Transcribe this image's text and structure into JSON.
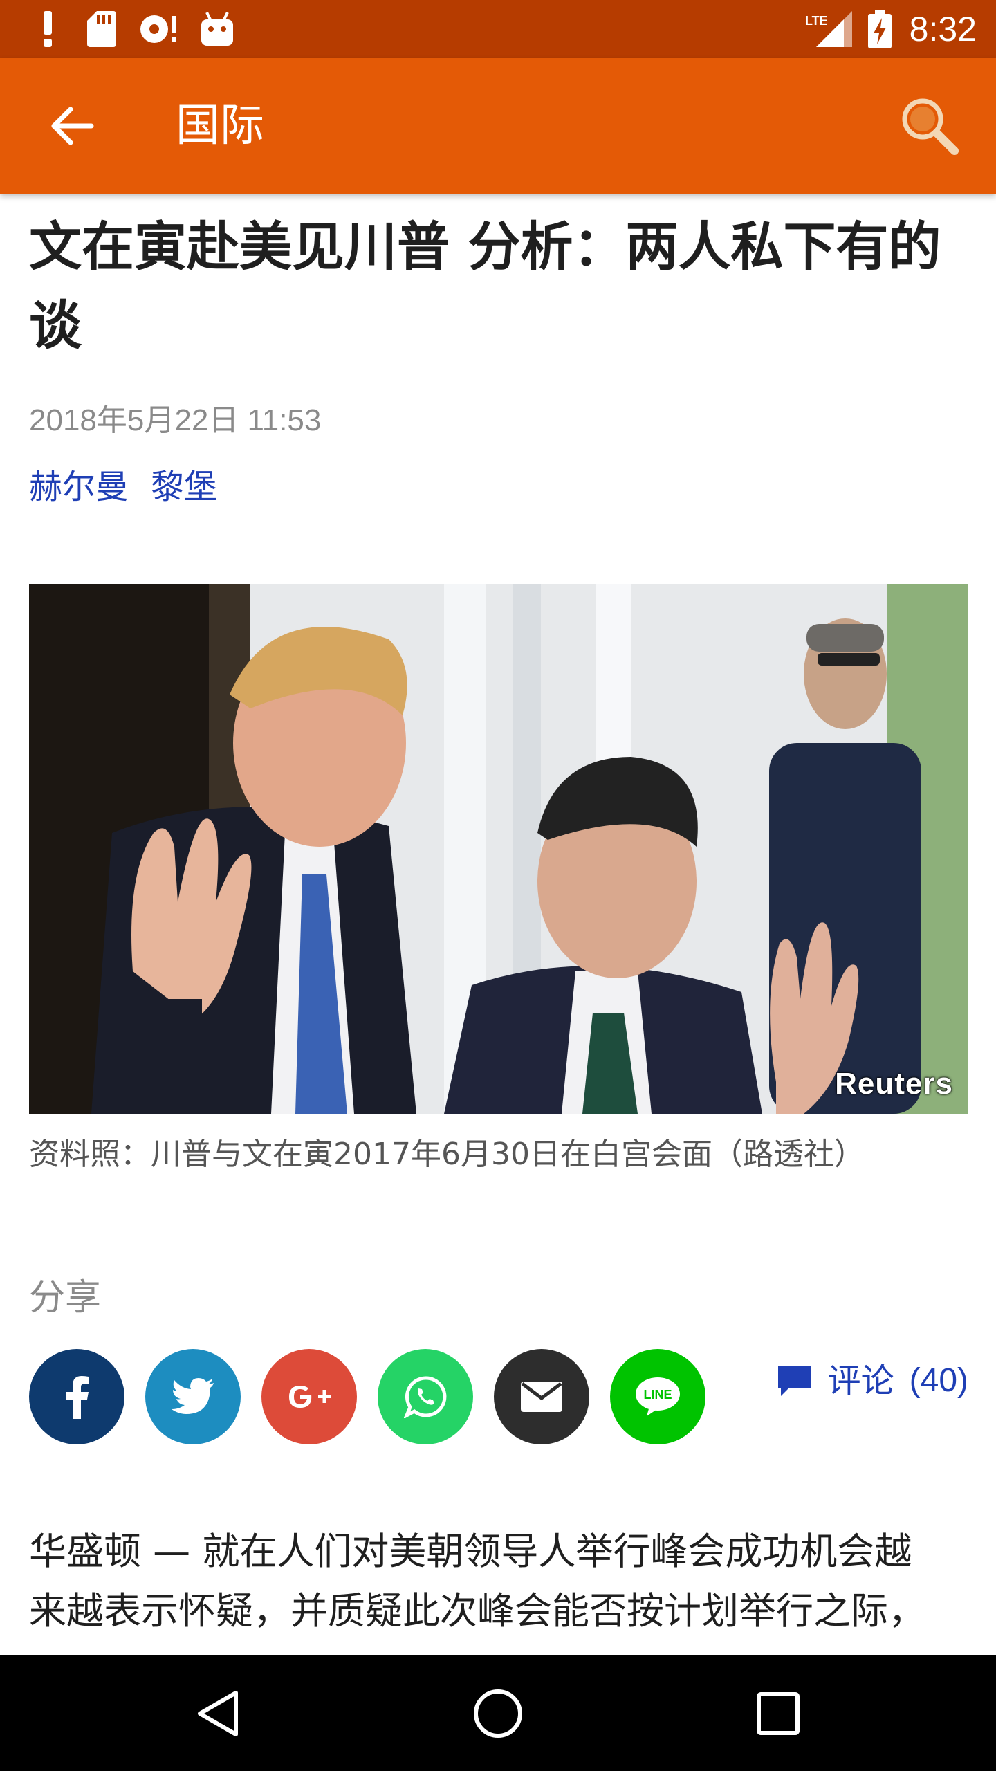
{
  "status_bar": {
    "time": "8:32",
    "network": "LTE",
    "icons": [
      "alert-icon",
      "sd-card-icon",
      "sync-icon",
      "android-icon",
      "signal-icon",
      "battery-charging-icon"
    ]
  },
  "app_bar": {
    "title": "国际",
    "back_icon": "arrow-left-icon",
    "search_icon": "search-icon"
  },
  "article": {
    "headline": "文在寅赴美见川普 分析：两人私下有的谈",
    "date": "2018年5月22日 11:53",
    "authors": [
      "赫尔曼",
      "黎堡"
    ],
    "photo_watermark": "Reuters",
    "caption": "资料照：川普与文在寅2017年6月30日在白宫会面（路透社）",
    "body_lines": [
      "华盛顿 — 就在人们对美朝领导人举行峰会成功机会越",
      "来越表示怀疑，并质疑此次峰会能否按计划举行之际，"
    ]
  },
  "share": {
    "label": "分享",
    "buttons": [
      {
        "name": "facebook",
        "icon": "facebook-icon",
        "color": "#0e3a6e"
      },
      {
        "name": "twitter",
        "icon": "twitter-icon",
        "color": "#1d8dc0"
      },
      {
        "name": "google-plus",
        "icon": "google-plus-icon",
        "color": "#dd4b39"
      },
      {
        "name": "whatsapp",
        "icon": "whatsapp-icon",
        "color": "#25d366"
      },
      {
        "name": "email",
        "icon": "email-icon",
        "color": "#2d2d2d"
      },
      {
        "name": "line",
        "icon": "line-icon",
        "color": "#00c300"
      }
    ]
  },
  "comments": {
    "label": "评论",
    "count": "(40)",
    "icon": "comment-icon",
    "color": "#1f3fb5"
  },
  "colors": {
    "status_bar": "#b63c00",
    "app_bar": "#e45a06",
    "link": "#1f3fb5"
  },
  "nav_bar": {
    "icons": [
      "back-triangle-icon",
      "home-circle-icon",
      "recents-square-icon"
    ]
  }
}
